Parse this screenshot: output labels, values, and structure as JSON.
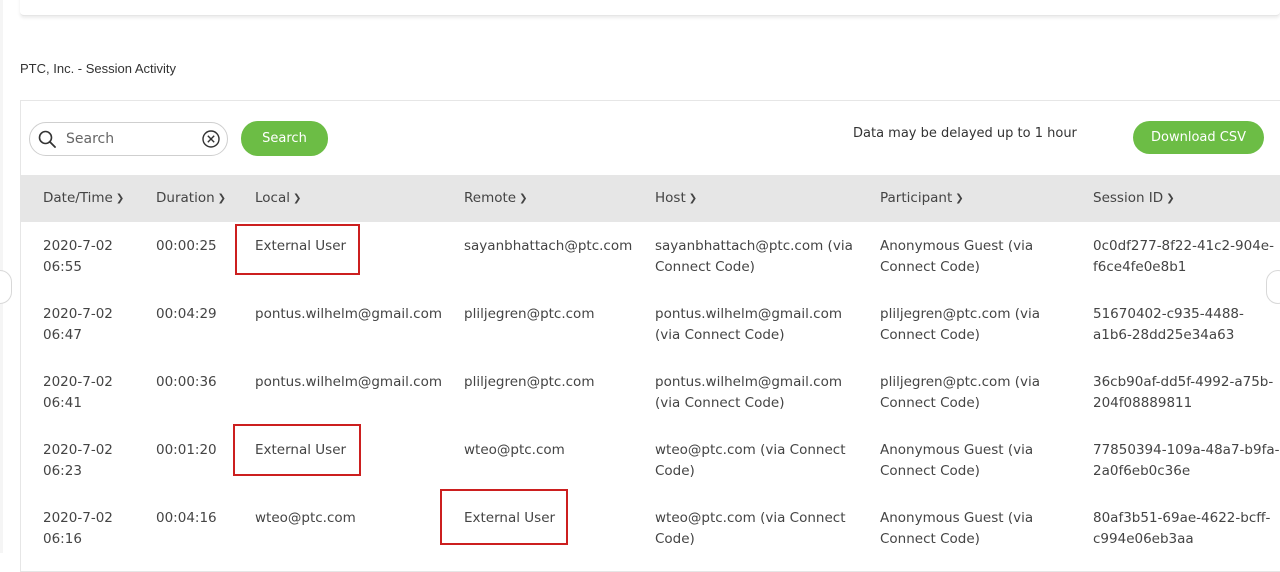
{
  "section": {
    "title": "PTC, Inc. - Session Activity"
  },
  "toolbar": {
    "search_placeholder": "Search",
    "search_button": "Search",
    "delay_note": "Data may be delayed up to 1 hour",
    "download_button": "Download CSV",
    "accent_color": "#6cbd45"
  },
  "columns": [
    "Date/Time",
    "Duration",
    "Local",
    "Remote",
    "Host",
    "Participant",
    "Session ID"
  ],
  "rows": [
    {
      "date_line1": "2020-7-02",
      "date_line2": "06:55",
      "duration": "00:00:25",
      "local": "External User",
      "remote": "sayanbhattach@ptc.com",
      "host_line1": "sayanbhattach@ptc.com (via",
      "host_line2": "Connect Code)",
      "participant_line1": "Anonymous Guest (via",
      "participant_line2": "Connect Code)",
      "session_line1": "0c0df277-8f22-41c2-904e-",
      "session_line2": "f6ce4fe0e8b1"
    },
    {
      "date_line1": "2020-7-02",
      "date_line2": "06:47",
      "duration": "00:04:29",
      "local": "pontus.wilhelm@gmail.com",
      "remote": "pliljegren@ptc.com",
      "host_line1": "pontus.wilhelm@gmail.com",
      "host_line2": "(via Connect Code)",
      "participant_line1": "pliljegren@ptc.com (via",
      "participant_line2": "Connect Code)",
      "session_line1": "51670402-c935-4488-",
      "session_line2": "a1b6-28dd25e34a63"
    },
    {
      "date_line1": "2020-7-02",
      "date_line2": "06:41",
      "duration": "00:00:36",
      "local": "pontus.wilhelm@gmail.com",
      "remote": "pliljegren@ptc.com",
      "host_line1": "pontus.wilhelm@gmail.com",
      "host_line2": "(via Connect Code)",
      "participant_line1": "pliljegren@ptc.com (via",
      "participant_line2": "Connect Code)",
      "session_line1": "36cb90af-dd5f-4992-a75b-",
      "session_line2": "204f08889811"
    },
    {
      "date_line1": "2020-7-02",
      "date_line2": "06:23",
      "duration": "00:01:20",
      "local": "External User",
      "remote": "wteo@ptc.com",
      "host_line1": "wteo@ptc.com (via Connect",
      "host_line2": "Code)",
      "participant_line1": "Anonymous Guest (via",
      "participant_line2": "Connect Code)",
      "session_line1": "77850394-109a-48a7-b9fa-",
      "session_line2": "2a0f6eb0c36e"
    },
    {
      "date_line1": "2020-7-02",
      "date_line2": "06:16",
      "duration": "00:04:16",
      "local": "wteo@ptc.com",
      "remote": "External User",
      "host_line1": "wteo@ptc.com (via Connect",
      "host_line2": "Code)",
      "participant_line1": "Anonymous Guest (via",
      "participant_line2": "Connect Code)",
      "session_line1": "80af3b51-69ae-4622-bcff-",
      "session_line2": "c994e06eb3aa"
    }
  ],
  "highlight_color": "#cc1f1f"
}
